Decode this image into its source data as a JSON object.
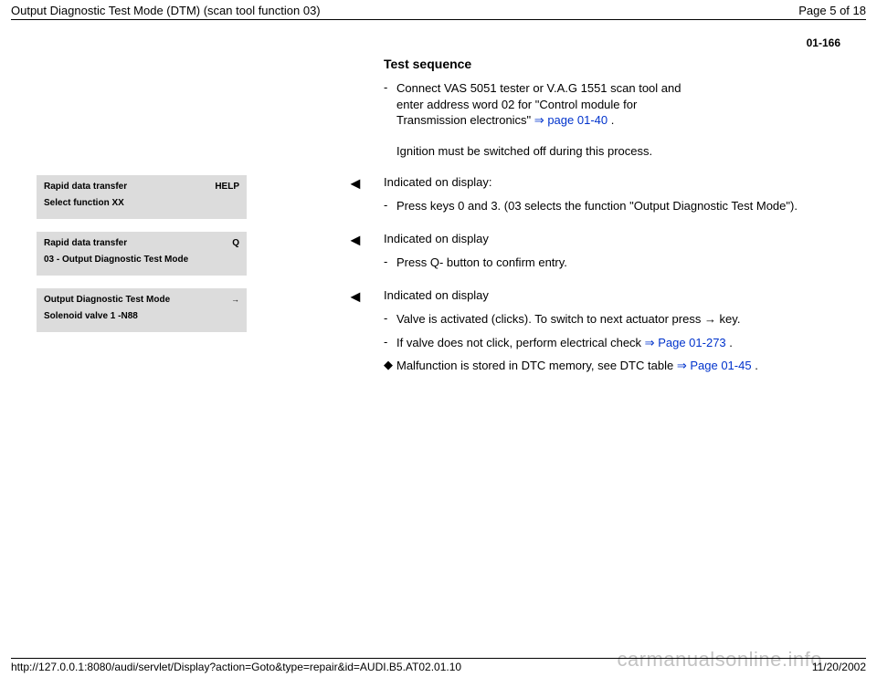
{
  "header": {
    "title": "Output Diagnostic Test Mode (DTM) (scan tool function 03)",
    "page_label": "Page 5 of 18"
  },
  "page_code": "01-166",
  "section_title": "Test sequence",
  "step1": {
    "bullet": "-",
    "text_before": "Connect VAS 5051 tester or V.A.G 1551 scan tool and enter address word 02 for \"Control module for Transmission electronics\"  ",
    "link_arrow": "⇒",
    "link_text": "page 01-40",
    "text_after": " ."
  },
  "note1": "Ignition must be switched off during this process.",
  "display1": {
    "line1_left": "Rapid data transfer",
    "line1_right": "HELP",
    "line2": "Select function XX"
  },
  "block1": {
    "pointer": "◄",
    "heading": "Indicated on display:",
    "bullet": "-",
    "text": "Press keys 0 and 3. (03 selects the function \"Output Diagnostic Test Mode\")."
  },
  "display2": {
    "line1_left": "Rapid data transfer",
    "line1_right": "Q",
    "line2": "03 - Output Diagnostic Test Mode"
  },
  "block2": {
    "pointer": "◄",
    "heading": "Indicated on display",
    "bullet": "-",
    "text": "Press Q- button to confirm entry."
  },
  "display3": {
    "line1_left": "Output Diagnostic Test Mode",
    "line1_right": "→",
    "line2": "Solenoid valve 1 -N88"
  },
  "block3": {
    "pointer": "◄",
    "heading": "Indicated on display",
    "b1_mark": "-",
    "b1_before": "Valve is activated (clicks). To switch to next actuator press ",
    "b1_arrow": "→",
    "b1_after": " key.",
    "b2_mark": "-",
    "b2_before": "If valve does not click, perform electrical check  ",
    "b2_link_arrow": "⇒",
    "b2_link": "Page 01-273",
    "b2_after": " .",
    "b3_mark": "◆",
    "b3_before": "Malfunction is stored in DTC memory, see DTC table  ",
    "b3_link_arrow": "⇒",
    "b3_link": "Page 01-45",
    "b3_after": " ."
  },
  "footer": {
    "url": "http://127.0.0.1:8080/audi/servlet/Display?action=Goto&type=repair&id=AUDI.B5.AT02.01.10",
    "date": "11/20/2002"
  },
  "watermark": "carmanualsonline.info"
}
